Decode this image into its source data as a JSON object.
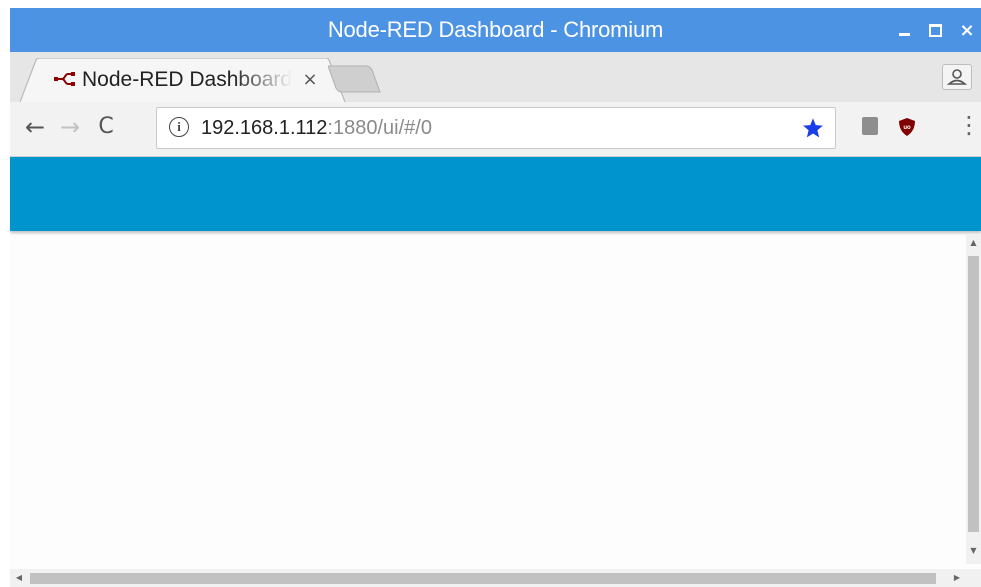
{
  "window": {
    "title": "Node-RED Dashboard - Chromium",
    "controls": {
      "minimize": "minimize",
      "maximize": "maximize",
      "close": "×"
    },
    "titlebar_color": "#4c93e3"
  },
  "tabs": [
    {
      "title": "Node-RED Dashboard",
      "favicon": "node-red-icon",
      "close": "×",
      "active": true
    }
  ],
  "toolbar": {
    "back": "←",
    "forward": "→",
    "reload": "C",
    "info_icon": "i",
    "url_host": "192.168.1.112",
    "url_rest": ":1880/ui/#/0",
    "bookmark_icon": "star-icon",
    "bookmark_color": "#1a3ee8",
    "extensions": [
      "extension-icon",
      "ublock-origin-icon"
    ],
    "menu": "⋮"
  },
  "page": {
    "header_color": "#0094ce",
    "scrollbar": {
      "up": "▲",
      "down": "▼",
      "left": "◀",
      "right": "▶"
    }
  }
}
